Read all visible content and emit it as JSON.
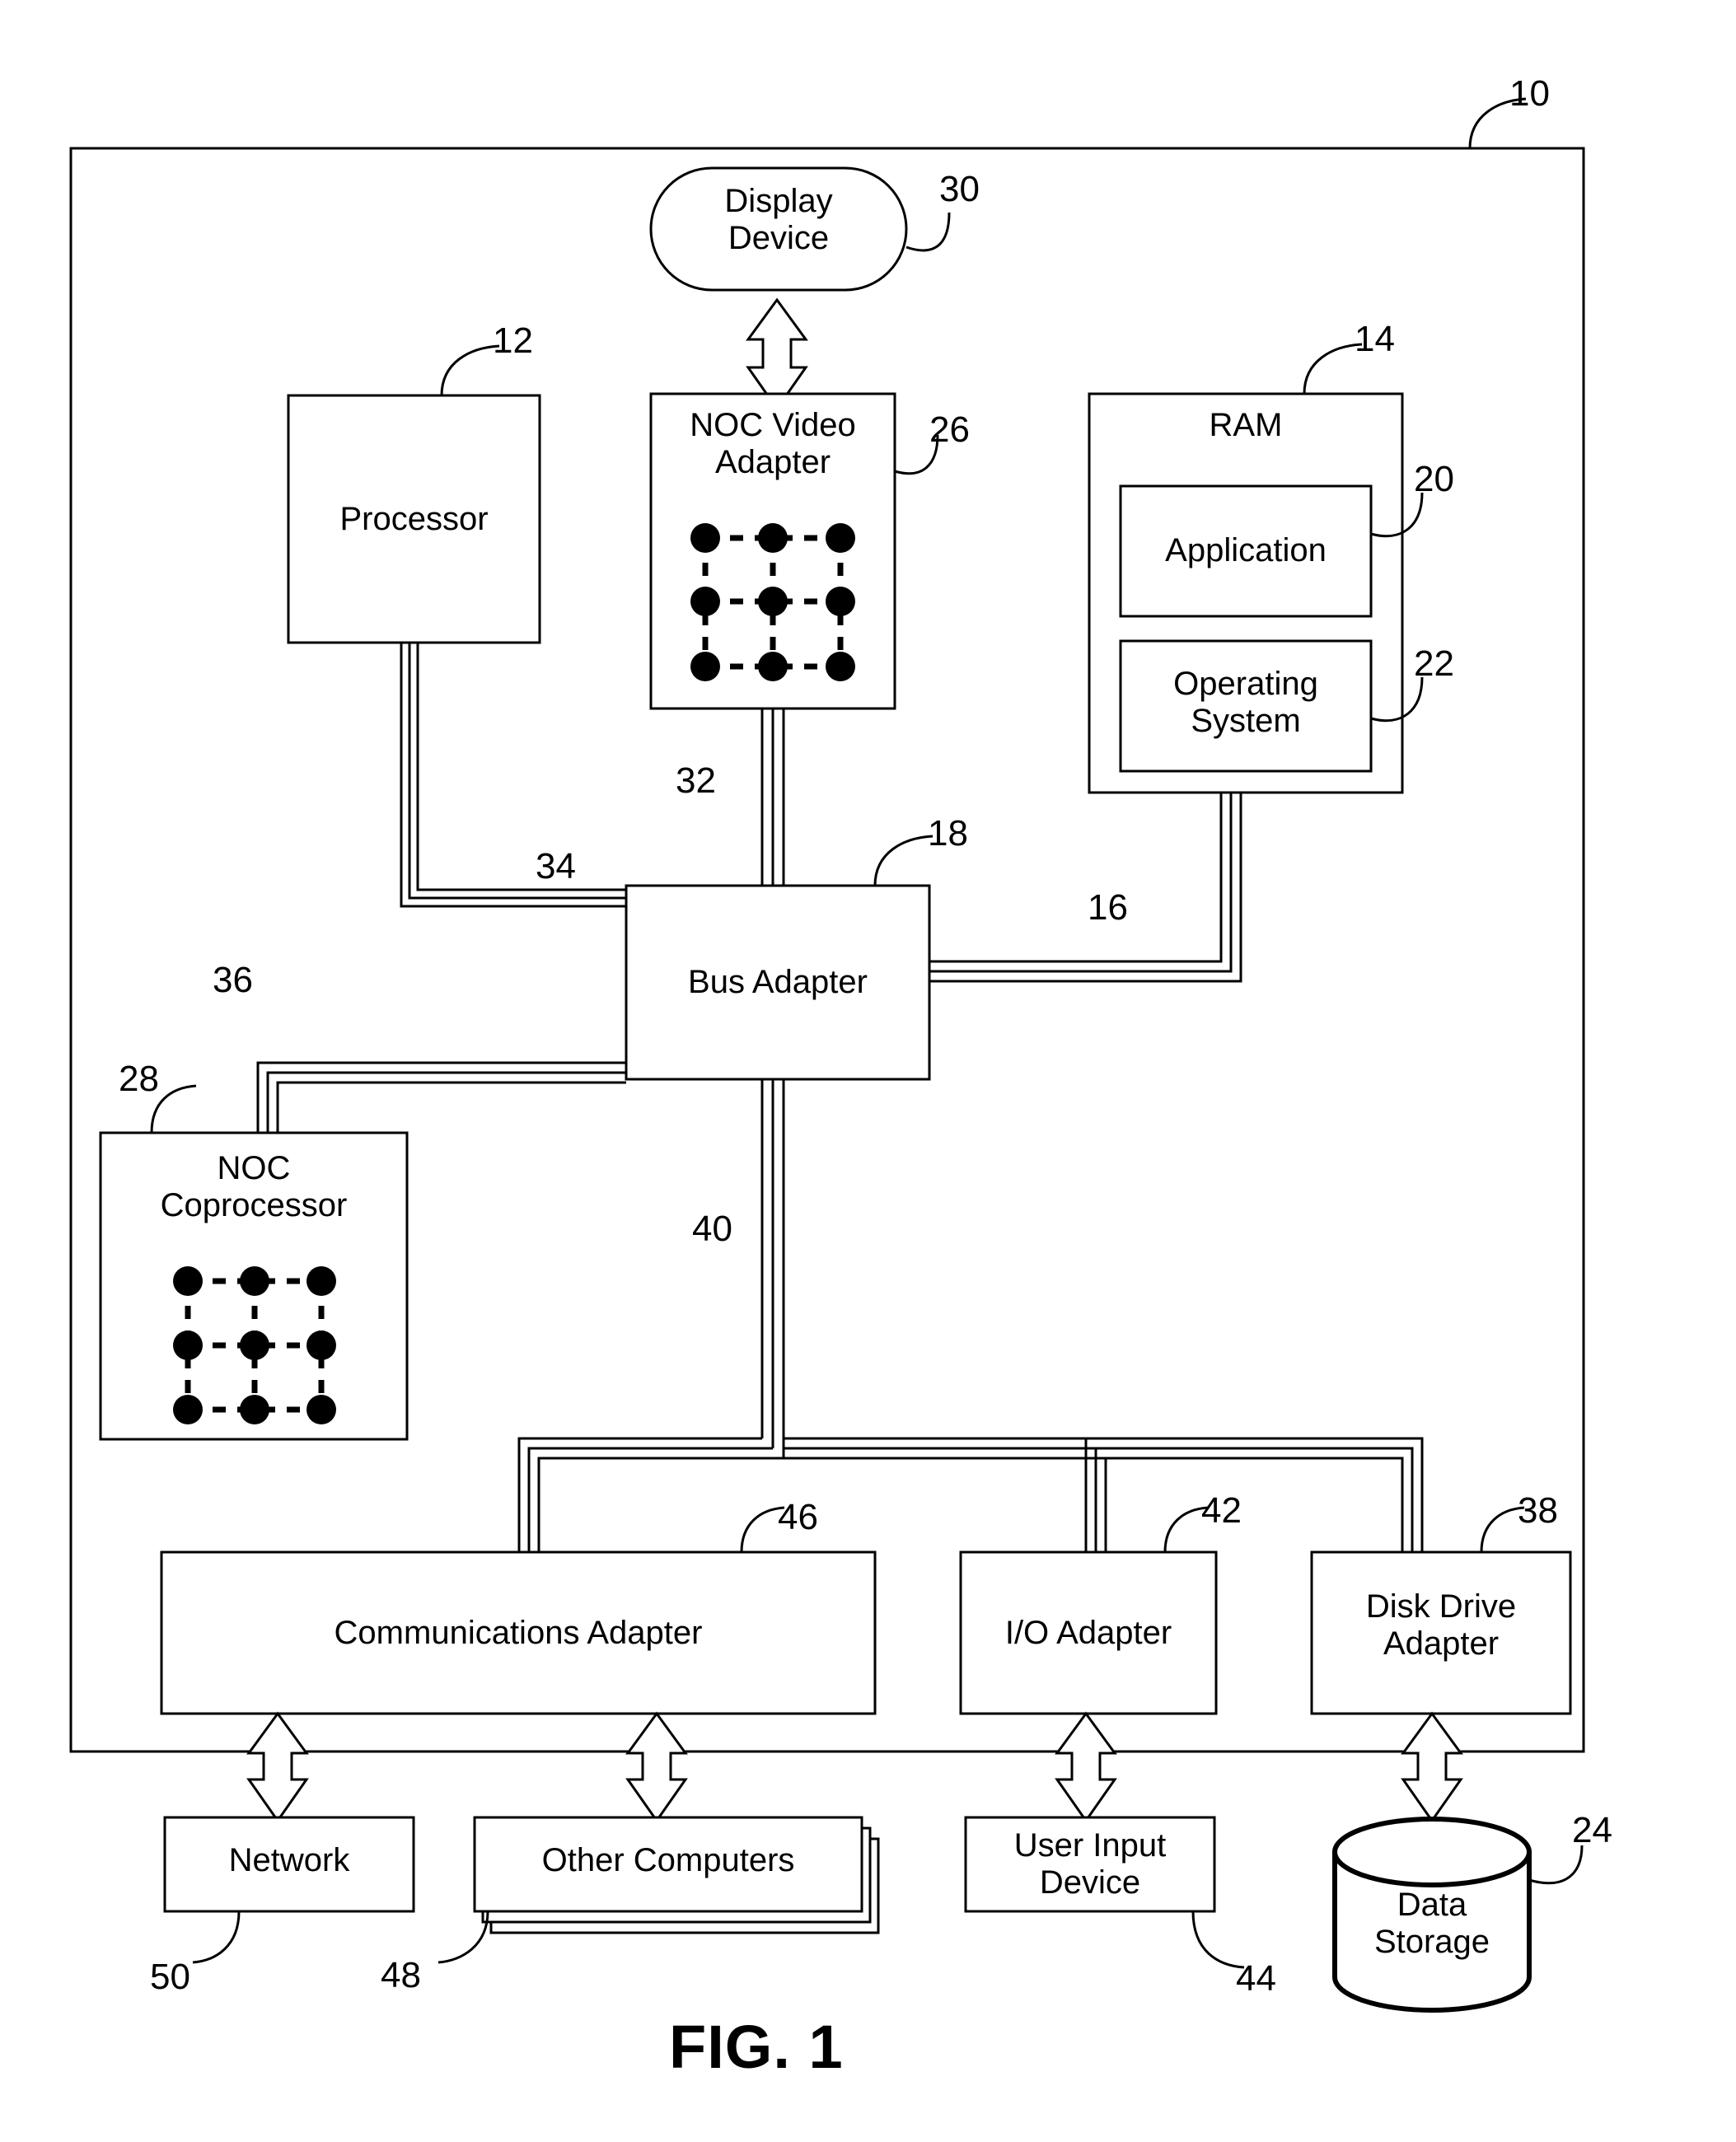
{
  "figure": {
    "caption": "FIG. 1",
    "system_ref": "10"
  },
  "nodes": [
    {
      "id": "display_device",
      "label": "Display\nDevice",
      "ref": "30",
      "shape": "rounded"
    },
    {
      "id": "processor",
      "label": "Processor",
      "ref": "12",
      "shape": "rect"
    },
    {
      "id": "noc_video_adapter",
      "label": "NOC Video\nAdapter",
      "ref": "26",
      "shape": "rect-noc"
    },
    {
      "id": "ram",
      "label": "RAM",
      "ref": "14",
      "shape": "rect"
    },
    {
      "id": "application",
      "label": "Application",
      "ref": "20",
      "shape": "rect"
    },
    {
      "id": "operating_system",
      "label": "Operating\nSystem",
      "ref": "22",
      "shape": "rect"
    },
    {
      "id": "bus_adapter",
      "label": "Bus Adapter",
      "ref": "18",
      "shape": "rect"
    },
    {
      "id": "noc_coprocessor",
      "label": "NOC\nCoprocessor",
      "ref": "28",
      "shape": "rect-noc"
    },
    {
      "id": "communications_adapter",
      "label": "Communications Adapter",
      "ref": "46",
      "shape": "rect"
    },
    {
      "id": "io_adapter",
      "label": "I/O Adapter",
      "ref": "42",
      "shape": "rect"
    },
    {
      "id": "disk_drive_adapter",
      "label": "Disk Drive\nAdapter",
      "ref": "38",
      "shape": "rect"
    },
    {
      "id": "network",
      "label": "Network",
      "ref": "50",
      "shape": "rect"
    },
    {
      "id": "other_computers",
      "label": "Other Computers",
      "ref": "48",
      "shape": "rect-stack"
    },
    {
      "id": "user_input_device",
      "label": "User Input\nDevice",
      "ref": "44",
      "shape": "rect"
    },
    {
      "id": "data_storage",
      "label": "Data\nStorage",
      "ref": "24",
      "shape": "cylinder"
    }
  ],
  "bus_refs": [
    {
      "id": "bus_ram",
      "ref": "16",
      "label": ""
    },
    {
      "id": "bus_video",
      "ref": "32",
      "label": ""
    },
    {
      "id": "bus_processor",
      "ref": "34",
      "label": ""
    },
    {
      "id": "bus_coprocessor",
      "ref": "36",
      "label": ""
    },
    {
      "id": "bus_expansion",
      "ref": "40",
      "label": ""
    }
  ],
  "labels": {
    "display_device": "Display\nDevice",
    "processor": "Processor",
    "noc_video_adapter": "NOC Video\nAdapter",
    "ram": "RAM",
    "application": "Application",
    "operating_system": "Operating\nSystem",
    "bus_adapter": "Bus Adapter",
    "noc_coprocessor": "NOC\nCoprocessor",
    "communications_adapter": "Communications Adapter",
    "io_adapter": "I/O Adapter",
    "disk_drive_adapter": "Disk Drive\nAdapter",
    "network": "Network",
    "other_computers": "Other Computers",
    "user_input_device": "User Input\nDevice",
    "data_storage": "Data\nStorage"
  },
  "refs": {
    "system": "10",
    "processor": "12",
    "ram": "14",
    "bus_ram": "16",
    "bus_adapter": "18",
    "application": "20",
    "operating_system": "22",
    "data_storage": "24",
    "noc_video_adapter": "26",
    "noc_coprocessor": "28",
    "display_device": "30",
    "bus_video": "32",
    "bus_processor": "34",
    "bus_coprocessor": "36",
    "disk_drive_adapter": "38",
    "bus_expansion": "40",
    "io_adapter": "42",
    "user_input_device": "44",
    "communications_adapter": "46",
    "other_computers": "48",
    "network": "50"
  },
  "style": {
    "stroke": "#000000",
    "background": "#ffffff",
    "noc_mesh": {
      "rows": 3,
      "cols": 3,
      "dot_style": "filled",
      "link_style": "dashed"
    }
  }
}
